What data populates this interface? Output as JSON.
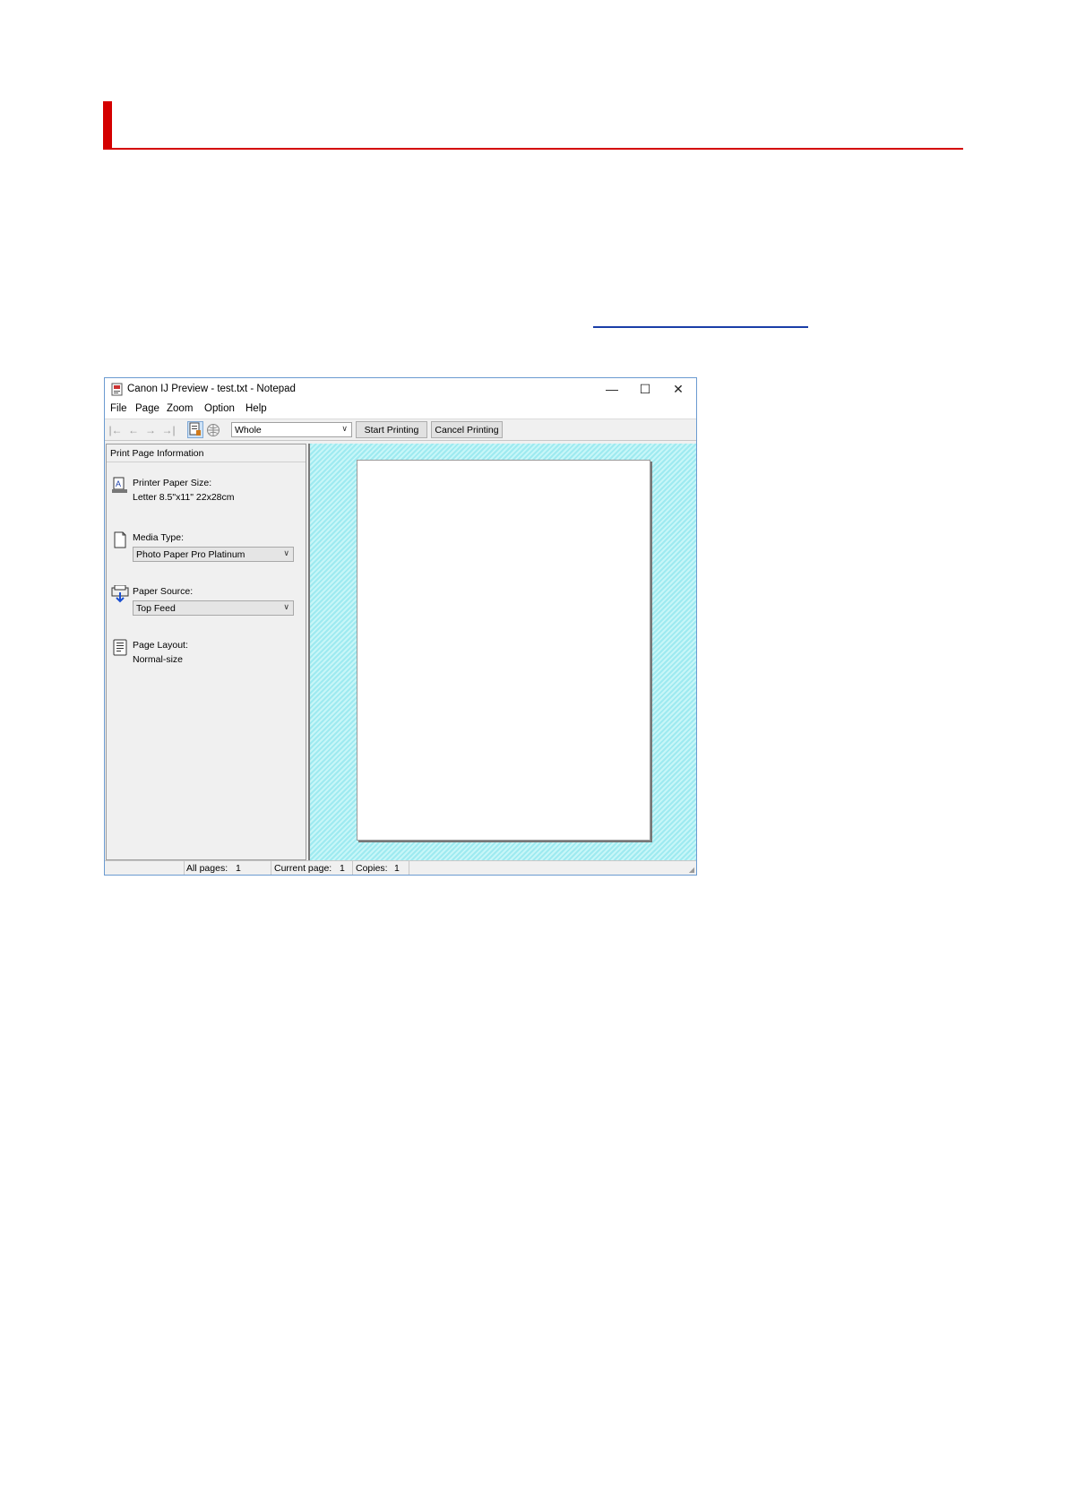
{
  "window": {
    "title": "Canon IJ Preview - test.txt - Notepad",
    "controls": {
      "minimize": "—",
      "maximize": "☐",
      "close": "✕"
    }
  },
  "menu": [
    "File",
    "Page",
    "Zoom",
    "Option",
    "Help"
  ],
  "toolbar": {
    "zoom_value": "Whole",
    "start_label": "Start Printing",
    "cancel_label": "Cancel Printing",
    "icons": [
      "first-page-icon",
      "previous-page-icon",
      "next-page-icon",
      "last-page-icon",
      "print-preview-icon",
      "web-icon"
    ]
  },
  "panel": {
    "title": "Print Page Information",
    "paper_size_label": "Printer Paper Size:",
    "paper_size_value": "Letter 8.5\"x11\" 22x28cm",
    "media_type_label": "Media Type:",
    "media_type_value": "Photo Paper Pro Platinum",
    "paper_source_label": "Paper Source:",
    "paper_source_value": "Top Feed",
    "page_layout_label": "Page Layout:",
    "page_layout_value": "Normal-size"
  },
  "status": {
    "all_pages_label": "All pages:",
    "all_pages_value": "1",
    "current_page_label": "Current page:",
    "current_page_value": "1",
    "copies_label": "Copies:",
    "copies_value": "1"
  },
  "colors": {
    "accent": "#d40000",
    "preview_bg": "#9eeaf0",
    "link": "#1a3ea8"
  }
}
